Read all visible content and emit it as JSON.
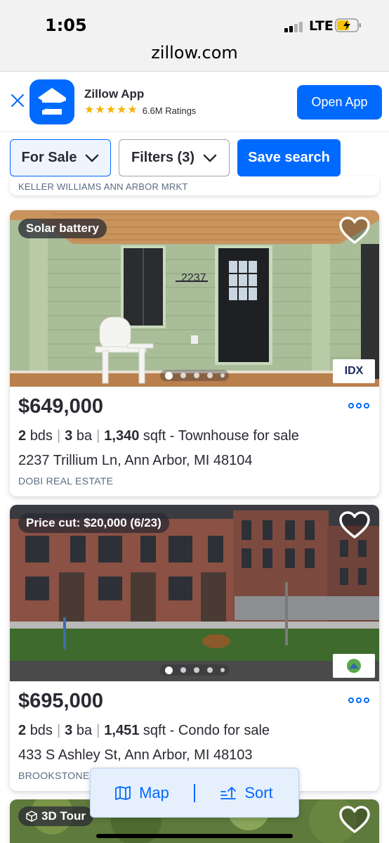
{
  "status_bar": {
    "time": "1:05",
    "network": "LTE"
  },
  "browser": {
    "url": "zillow.com"
  },
  "app_banner": {
    "app_name": "Zillow App",
    "rating_stars": 5,
    "ratings_text": "6.6M Ratings",
    "open_label": "Open App"
  },
  "filters": {
    "for_sale_label": "For Sale",
    "filters_label": "Filters (3)",
    "save_search_label": "Save search"
  },
  "previous_listing": {
    "broker": "KELLER WILLIAMS ANN ARBOR MRKT"
  },
  "listings": [
    {
      "badge": "Solar battery",
      "price": "$649,000",
      "beds": "2",
      "beds_unit": "bds",
      "baths": "3",
      "baths_unit": "ba",
      "sqft": "1,340",
      "sqft_unit": "sqft",
      "type": "- Townhouse for sale",
      "address": "2237 Trillium Ln, Ann Arbor, MI 48104",
      "broker": "DOBI REAL ESTATE",
      "mls_logo": "IDX",
      "house_number": "2237"
    },
    {
      "badge": "Price cut: $20,000 (6/23)",
      "price": "$695,000",
      "beds": "2",
      "beds_unit": "bds",
      "baths": "3",
      "baths_unit": "ba",
      "sqft": "1,451",
      "sqft_unit": "sqft",
      "type": "- Condo for sale",
      "address": "433 S Ashley St, Ann Arbor, MI 48103",
      "broker": "BROOKSTONE,"
    },
    {
      "badge": "3D Tour"
    }
  ],
  "bottom_bar": {
    "map_label": "Map",
    "sort_label": "Sort"
  },
  "colors": {
    "brand_blue": "#006aff",
    "text": "#2a2a33",
    "star": "#f5b400"
  },
  "icons": [
    "close-icon",
    "zillow-logo-icon",
    "star-icon",
    "chevron-down-icon",
    "heart-icon",
    "more-icon",
    "map-icon",
    "sort-icon",
    "cube-icon"
  ]
}
